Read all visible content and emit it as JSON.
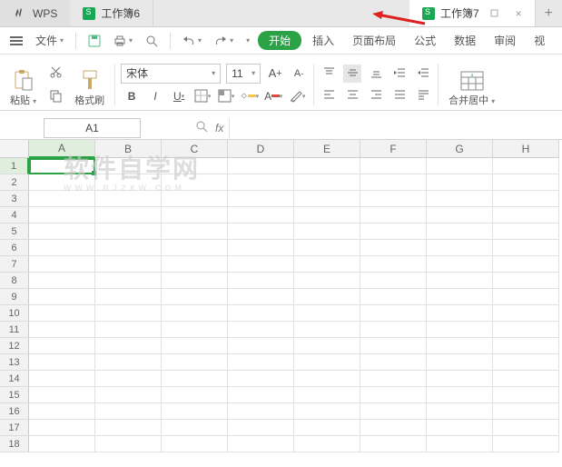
{
  "title": {
    "brand": "WPS"
  },
  "tabs": [
    {
      "label": "工作簿6",
      "active": false
    },
    {
      "label": "工作簿7",
      "active": true
    }
  ],
  "new_tab_glyph": "+",
  "menubar": {
    "file": "文件",
    "start": "开始",
    "insert": "插入",
    "page_layout": "页面布局",
    "formula": "公式",
    "data": "数据",
    "review": "审阅",
    "view": "视"
  },
  "ribbon": {
    "paste": "粘贴",
    "format_painter": "格式刷",
    "font_name": "宋体",
    "font_size": "11",
    "bold": "B",
    "italic": "I",
    "underline": "U",
    "merge_center": "合并居中"
  },
  "formula_bar": {
    "name_box": "A1",
    "fx": "fx"
  },
  "sheet": {
    "columns": [
      "A",
      "B",
      "C",
      "D",
      "E",
      "F",
      "G",
      "H"
    ],
    "rows": [
      "1",
      "2",
      "3",
      "4",
      "5",
      "6",
      "7",
      "8",
      "9",
      "10",
      "11",
      "12",
      "13",
      "14",
      "15",
      "16",
      "17",
      "18"
    ],
    "active_col": "A",
    "active_row": "1"
  },
  "watermark": {
    "main": "软件自学网",
    "sub": "WWW.RJZXW.COM"
  },
  "colors": {
    "accent": "#2ba245",
    "highlight_bar_yellow": "#f2c94c",
    "highlight_bar_red": "#d84b3a"
  }
}
